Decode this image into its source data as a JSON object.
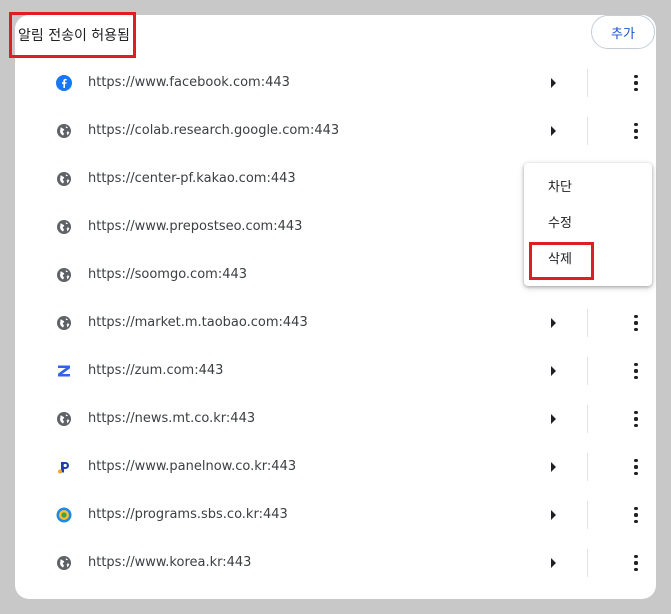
{
  "section": {
    "title": "알림 전송이 허용됨"
  },
  "toolbar": {
    "add_label": "추가"
  },
  "sites": [
    {
      "url": "https://www.facebook.com:443",
      "icon": "facebook-icon"
    },
    {
      "url": "https://colab.research.google.com:443",
      "icon": "globe-icon"
    },
    {
      "url": "https://center-pf.kakao.com:443",
      "icon": "globe-icon"
    },
    {
      "url": "https://www.prepostseo.com:443",
      "icon": "globe-icon"
    },
    {
      "url": "https://soomgo.com:443",
      "icon": "globe-icon"
    },
    {
      "url": "https://market.m.taobao.com:443",
      "icon": "globe-icon"
    },
    {
      "url": "https://zum.com:443",
      "icon": "zum-icon"
    },
    {
      "url": "https://news.mt.co.kr:443",
      "icon": "globe-icon"
    },
    {
      "url": "https://www.panelnow.co.kr:443",
      "icon": "panelnow-icon"
    },
    {
      "url": "https://programs.sbs.co.kr:443",
      "icon": "sbs-icon"
    },
    {
      "url": "https://www.korea.kr:443",
      "icon": "globe-icon"
    }
  ],
  "menu": {
    "block": "차단",
    "edit": "수정",
    "delete": "삭제"
  },
  "colors": {
    "accent": "#1a56c4",
    "highlight": "#e01c24",
    "facebook": "#1877f2",
    "zum": "#2f63f0"
  }
}
